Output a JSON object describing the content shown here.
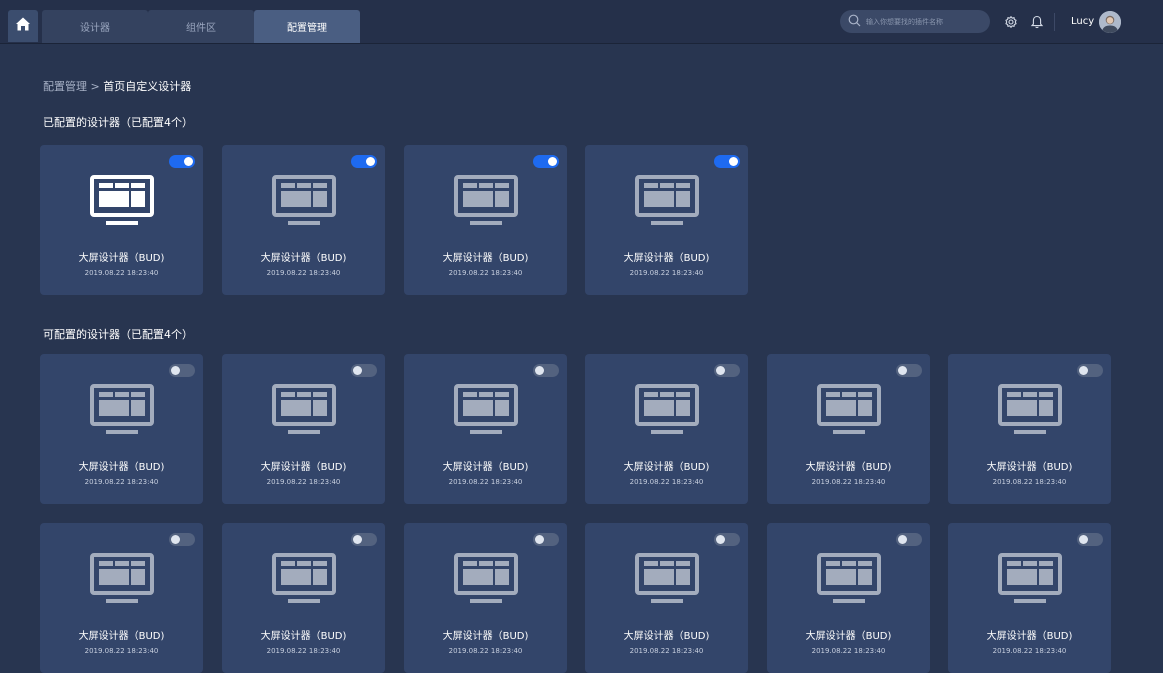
{
  "nav": {
    "home_icon": "home-icon",
    "tabs": [
      {
        "label": "设计器",
        "active": false
      },
      {
        "label": "组件区",
        "active": false
      },
      {
        "label": "配置管理",
        "active": true
      }
    ],
    "search_placeholder": "输入你想要找的插件名称",
    "settings_icon": "gear-icon",
    "notification_icon": "bell-icon",
    "user": "Lucy"
  },
  "breadcrumb": {
    "parent": "配置管理",
    "separator": ">",
    "current": "首页自定义设计器"
  },
  "configured": {
    "title": "已配置的设计器（已配置4个）",
    "cards": [
      {
        "name": "大屏设计器（BUD)",
        "time": "2019.08.22 18:23:40",
        "enabled": true,
        "highlight": true
      },
      {
        "name": "大屏设计器（BUD)",
        "time": "2019.08.22 18:23:40",
        "enabled": true,
        "highlight": false
      },
      {
        "name": "大屏设计器（BUD)",
        "time": "2019.08.22 18:23:40",
        "enabled": true,
        "highlight": false
      },
      {
        "name": "大屏设计器（BUD)",
        "time": "2019.08.22 18:23:40",
        "enabled": true,
        "highlight": false
      }
    ]
  },
  "available": {
    "title": "可配置的设计器（已配置4个）",
    "cards": [
      {
        "name": "大屏设计器（BUD)",
        "time": "2019.08.22 18:23:40",
        "enabled": false
      },
      {
        "name": "大屏设计器（BUD)",
        "time": "2019.08.22 18:23:40",
        "enabled": false
      },
      {
        "name": "大屏设计器（BUD)",
        "time": "2019.08.22 18:23:40",
        "enabled": false
      },
      {
        "name": "大屏设计器（BUD)",
        "time": "2019.08.22 18:23:40",
        "enabled": false
      },
      {
        "name": "大屏设计器（BUD)",
        "time": "2019.08.22 18:23:40",
        "enabled": false
      },
      {
        "name": "大屏设计器（BUD)",
        "time": "2019.08.22 18:23:40",
        "enabled": false
      },
      {
        "name": "大屏设计器（BUD)",
        "time": "2019.08.22 18:23:40",
        "enabled": false
      },
      {
        "name": "大屏设计器（BUD)",
        "time": "2019.08.22 18:23:40",
        "enabled": false
      },
      {
        "name": "大屏设计器（BUD)",
        "time": "2019.08.22 18:23:40",
        "enabled": false
      },
      {
        "name": "大屏设计器（BUD)",
        "time": "2019.08.22 18:23:40",
        "enabled": false
      },
      {
        "name": "大屏设计器（BUD)",
        "time": "2019.08.22 18:23:40",
        "enabled": false
      },
      {
        "name": "大屏设计器（BUD)",
        "time": "2019.08.22 18:23:40",
        "enabled": false
      }
    ]
  },
  "colors": {
    "accent": "#1e6af0",
    "card": "#33456a",
    "background": "#283550"
  }
}
